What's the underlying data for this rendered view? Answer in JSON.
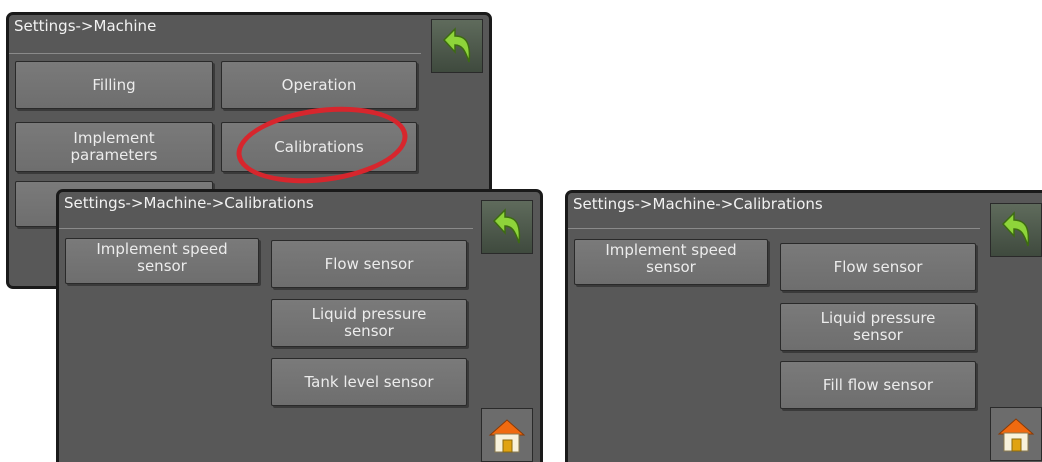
{
  "screen_machine": {
    "title": "Settings->Machine",
    "buttons": {
      "filling": "Filling",
      "operation": "Operation",
      "implement_parameters": "Implement parameters",
      "calibrations": "Calibrations"
    }
  },
  "screen_calibrations_1": {
    "title": "Settings->Machine->Calibrations",
    "buttons": {
      "implement_speed_sensor": "Implement speed sensor",
      "flow_sensor": "Flow sensor",
      "liquid_pressure_sensor": "Liquid pressure sensor",
      "tank_level_sensor": "Tank level sensor"
    }
  },
  "screen_calibrations_2": {
    "title": "Settings->Machine->Calibrations",
    "buttons": {
      "implement_speed_sensor": "Implement speed sensor",
      "flow_sensor": "Flow sensor",
      "liquid_pressure_sensor": "Liquid pressure sensor",
      "fill_flow_sensor": "Fill flow sensor"
    }
  },
  "icons": {
    "back": "back-arrow-icon",
    "home": "home-icon"
  },
  "colors": {
    "screen_bg": "#585858",
    "button_bg": "#757575",
    "back_arrow": "#8ed43a",
    "highlight": "#d7262d"
  }
}
